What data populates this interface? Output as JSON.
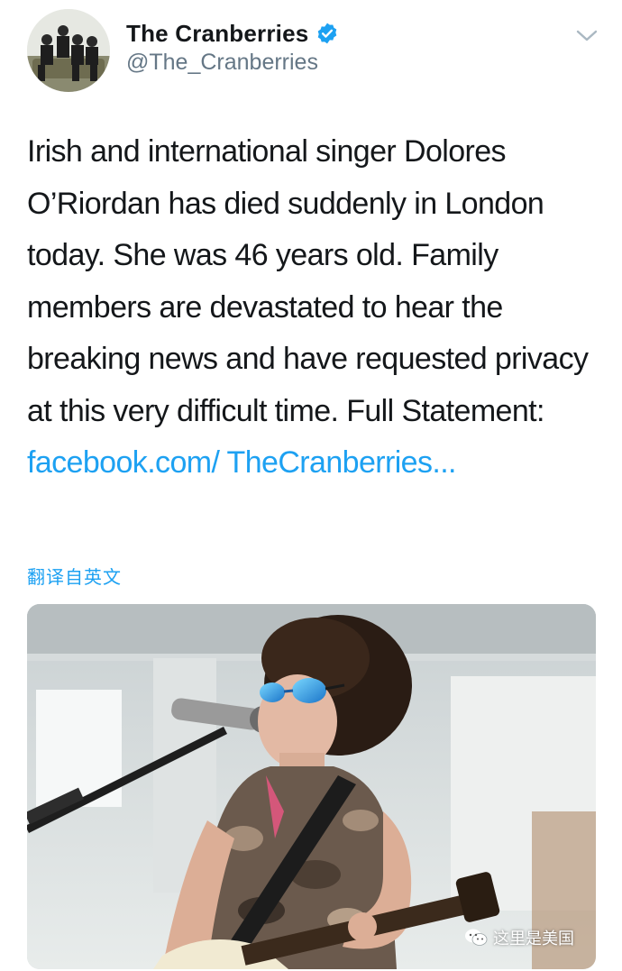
{
  "tweet": {
    "author": {
      "name": "The Cranberries",
      "handle": "@The_Cranberries",
      "verified": true
    },
    "text_parts": [
      "Irish and international singer Dolores O’Riordan has died suddenly in London today. She was 46 years old. Family members are devastated to hear the breaking news and have requested privacy at this very difficult time. Full Statement: "
    ],
    "link_text": "facebook.com/ TheCranberries...",
    "translate_label": "翻译自英文",
    "watermark_text": "这里是美国"
  },
  "colors": {
    "link": "#1da1f2",
    "handle": "#657786",
    "text": "#14171a",
    "verified": "#1da1f2"
  },
  "icons": [
    "verified-badge-icon",
    "chevron-down-icon",
    "wechat-icon"
  ]
}
